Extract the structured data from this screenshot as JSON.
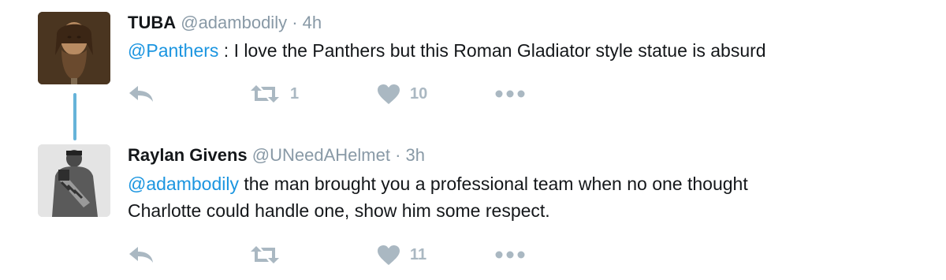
{
  "tweets": [
    {
      "fullname": "TUBA",
      "username": "@adambodily",
      "separator": "·",
      "time": "4h",
      "mention": "@Panthers",
      "text": " : I love the Panthers but this Roman Gladiator style statue is absurd",
      "text_line2": "",
      "retweet_count": "1",
      "like_count": "10"
    },
    {
      "fullname": "Raylan Givens",
      "username": "@UNeedAHelmet",
      "separator": "·",
      "time": "3h",
      "mention": "@adambodily",
      "text": " the man brought you a professional team when no one thought",
      "text_line2": "Charlotte could handle one, show him some respect.",
      "retweet_count": "",
      "like_count": "11"
    }
  ],
  "colors": {
    "icon": "#aab8c2",
    "mention": "#1b95e0",
    "thread_line": "#66b3d9"
  },
  "icons": [
    "reply-icon",
    "retweet-icon",
    "heart-icon",
    "more-icon"
  ]
}
